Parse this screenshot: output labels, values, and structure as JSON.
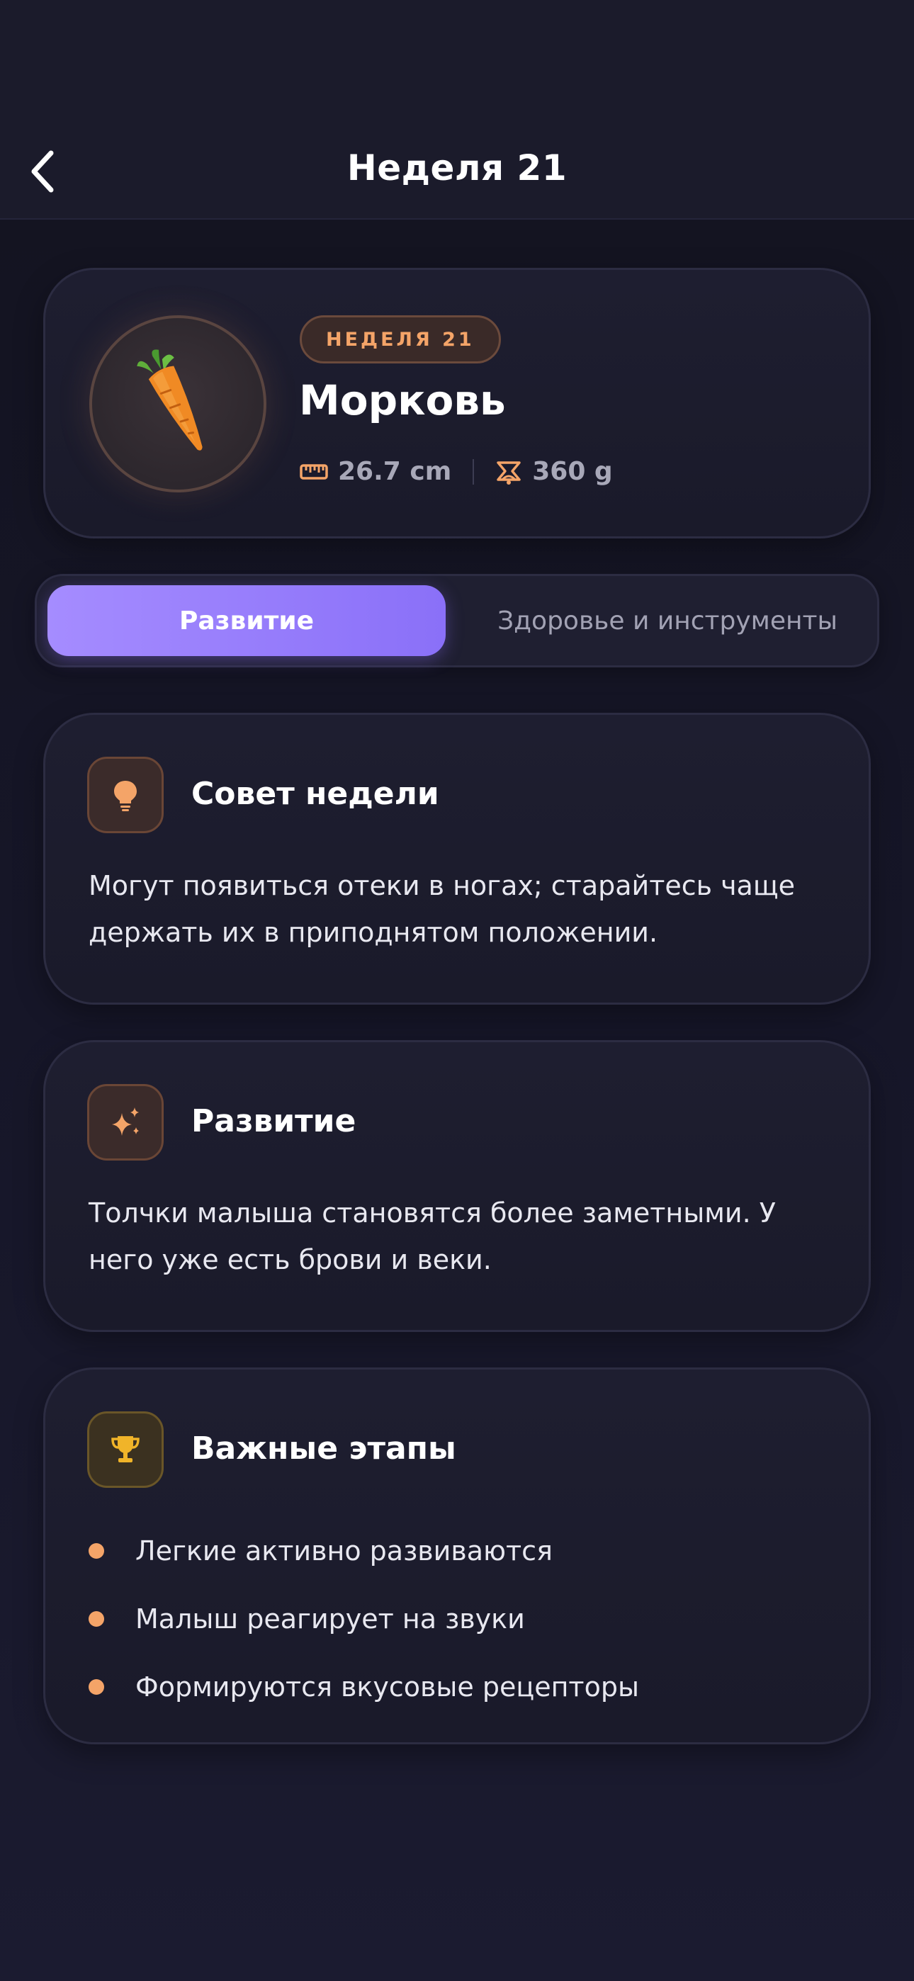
{
  "header": {
    "title": "Неделя 21",
    "back_icon": "chevron-left-icon"
  },
  "hero": {
    "badge": "НЕДЕЛЯ 21",
    "fruit_name": "Морковь",
    "fruit_icon": "carrot-icon",
    "length_icon": "ruler-icon",
    "length": "26.7 cm",
    "weight_icon": "scale-icon",
    "weight": "360 g"
  },
  "tabs": [
    {
      "label": "Развитие",
      "active": true
    },
    {
      "label": "Здоровье и инструменты",
      "active": false
    }
  ],
  "tip_card": {
    "icon": "lightbulb-icon",
    "title": "Совет недели",
    "text": "Могут появиться отеки в ногах; старайтесь чаще держать их в приподнятом положении."
  },
  "development_card": {
    "icon": "sparkles-icon",
    "title": "Развитие",
    "text": "Толчки малыша становятся более заметными. У него уже есть брови и веки."
  },
  "milestones_card": {
    "icon": "trophy-icon",
    "title": "Важные этапы",
    "items": [
      "Легкие активно развиваются",
      "Малыш реагирует на звуки",
      "Формируются вкусовые рецепторы"
    ]
  },
  "colors": {
    "accent_purple": "#9b83ff",
    "accent_orange": "#f4a468",
    "accent_gold": "#f0b429",
    "background": "#161628"
  }
}
